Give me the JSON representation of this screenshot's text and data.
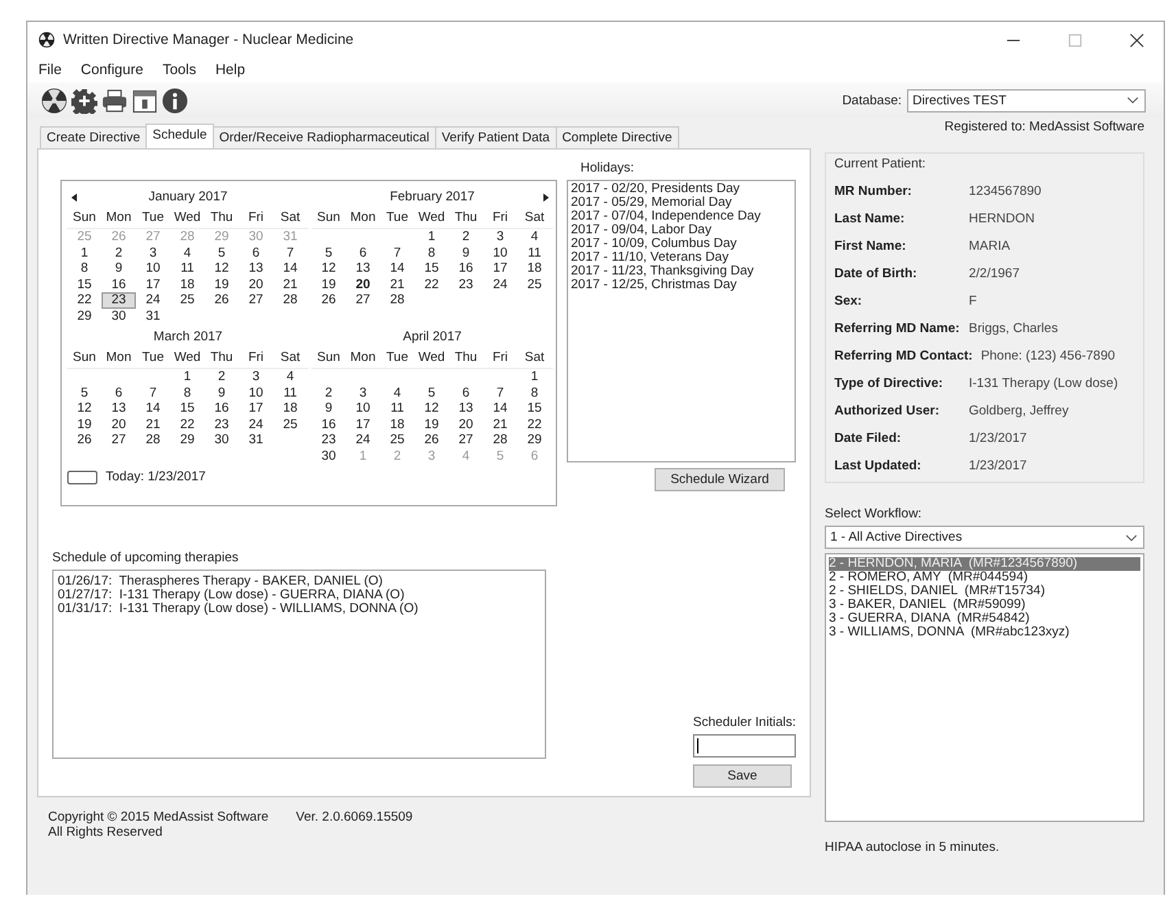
{
  "window": {
    "title": "Written Directive Manager - Nuclear Medicine"
  },
  "menu": [
    "File",
    "Configure",
    "Tools",
    "Help"
  ],
  "toolbar": [
    {
      "kind": "radiation"
    },
    {
      "kind": "gear"
    },
    {
      "kind": "printer"
    },
    {
      "kind": "calendar"
    },
    {
      "kind": "info"
    }
  ],
  "database": {
    "label": "Database:",
    "value": "Directives TEST"
  },
  "registered": "Registered to: MedAssist Software",
  "tabs": [
    {
      "label": "Create Directive",
      "selected": false
    },
    {
      "label": "Schedule",
      "selected": true
    },
    {
      "label": "Order/Receive Radiopharmaceutical",
      "selected": false
    },
    {
      "label": "Verify Patient Data",
      "selected": false
    },
    {
      "label": "Complete Directive",
      "selected": false
    }
  ],
  "calendar": {
    "today": "Today: 1/23/2017",
    "months": [
      {
        "title": "January 2017",
        "weekdays": [
          "Sun",
          "Mon",
          "Tue",
          "Wed",
          "Thu",
          "Fri",
          "Sat"
        ],
        "weeks": [
          [
            {
              "text": "25",
              "kind": "other",
              "selected": false
            },
            {
              "text": "26",
              "kind": "other",
              "selected": false
            },
            {
              "text": "27",
              "kind": "other",
              "selected": false
            },
            {
              "text": "28",
              "kind": "other",
              "selected": false
            },
            {
              "text": "29",
              "kind": "other",
              "selected": false
            },
            {
              "text": "30",
              "kind": "other",
              "selected": false
            },
            {
              "text": "31",
              "kind": "other",
              "selected": false
            }
          ],
          [
            {
              "text": "1",
              "kind": "day",
              "selected": false
            },
            {
              "text": "2",
              "kind": "day",
              "selected": false
            },
            {
              "text": "3",
              "kind": "day",
              "selected": false
            },
            {
              "text": "4",
              "kind": "day",
              "selected": false
            },
            {
              "text": "5",
              "kind": "day",
              "selected": false
            },
            {
              "text": "6",
              "kind": "day",
              "selected": false
            },
            {
              "text": "7",
              "kind": "day",
              "selected": false
            }
          ],
          [
            {
              "text": "8",
              "kind": "day",
              "selected": false
            },
            {
              "text": "9",
              "kind": "day",
              "selected": false
            },
            {
              "text": "10",
              "kind": "day",
              "selected": false
            },
            {
              "text": "11",
              "kind": "day",
              "selected": false
            },
            {
              "text": "12",
              "kind": "day",
              "selected": false
            },
            {
              "text": "13",
              "kind": "day",
              "selected": false
            },
            {
              "text": "14",
              "kind": "day",
              "selected": false
            }
          ],
          [
            {
              "text": "15",
              "kind": "day",
              "selected": false
            },
            {
              "text": "16",
              "kind": "day",
              "selected": false
            },
            {
              "text": "17",
              "kind": "day",
              "selected": false
            },
            {
              "text": "18",
              "kind": "day",
              "selected": false
            },
            {
              "text": "19",
              "kind": "day",
              "selected": false
            },
            {
              "text": "20",
              "kind": "day",
              "selected": false
            },
            {
              "text": "21",
              "kind": "day",
              "selected": false
            }
          ],
          [
            {
              "text": "22",
              "kind": "day",
              "selected": false
            },
            {
              "text": "23",
              "kind": "day",
              "selected": true
            },
            {
              "text": "24",
              "kind": "day",
              "selected": false
            },
            {
              "text": "25",
              "kind": "day",
              "selected": false
            },
            {
              "text": "26",
              "kind": "day",
              "selected": false
            },
            {
              "text": "27",
              "kind": "day",
              "selected": false
            },
            {
              "text": "28",
              "kind": "day",
              "selected": false
            }
          ],
          [
            {
              "text": "29",
              "kind": "day",
              "selected": false
            },
            {
              "text": "30",
              "kind": "day",
              "selected": false
            },
            {
              "text": "31",
              "kind": "day",
              "selected": false
            }
          ]
        ]
      },
      {
        "title": "February 2017",
        "weekdays": [
          "Sun",
          "Mon",
          "Tue",
          "Wed",
          "Thu",
          "Fri",
          "Sat"
        ],
        "weeks": [
          [
            {
              "text": "1",
              "kind": "day",
              "selected": false
            },
            {
              "text": "2",
              "kind": "day",
              "selected": false
            },
            {
              "text": "3",
              "kind": "day",
              "selected": false
            },
            {
              "text": "4",
              "kind": "day",
              "selected": false
            }
          ],
          [
            {
              "text": "5",
              "kind": "day",
              "selected": false
            },
            {
              "text": "6",
              "kind": "day",
              "selected": false
            },
            {
              "text": "7",
              "kind": "day",
              "selected": false
            },
            {
              "text": "8",
              "kind": "day",
              "selected": false
            },
            {
              "text": "9",
              "kind": "day",
              "selected": false
            },
            {
              "text": "10",
              "kind": "day",
              "selected": false
            },
            {
              "text": "11",
              "kind": "day",
              "selected": false
            }
          ],
          [
            {
              "text": "12",
              "kind": "day",
              "selected": false
            },
            {
              "text": "13",
              "kind": "day",
              "selected": false
            },
            {
              "text": "14",
              "kind": "day",
              "selected": false
            },
            {
              "text": "15",
              "kind": "day",
              "selected": false
            },
            {
              "text": "16",
              "kind": "day",
              "selected": false
            },
            {
              "text": "17",
              "kind": "day",
              "selected": false
            },
            {
              "text": "18",
              "kind": "day",
              "selected": false
            }
          ],
          [
            {
              "text": "19",
              "kind": "day",
              "selected": false
            },
            {
              "text": "20",
              "kind": "holiday",
              "selected": false
            },
            {
              "text": "21",
              "kind": "day",
              "selected": false
            },
            {
              "text": "22",
              "kind": "day",
              "selected": false
            },
            {
              "text": "23",
              "kind": "day",
              "selected": false
            },
            {
              "text": "24",
              "kind": "day",
              "selected": false
            },
            {
              "text": "25",
              "kind": "day",
              "selected": false
            }
          ],
          [
            {
              "text": "26",
              "kind": "day",
              "selected": false
            },
            {
              "text": "27",
              "kind": "day",
              "selected": false
            },
            {
              "text": "28",
              "kind": "day",
              "selected": false
            }
          ]
        ]
      },
      {
        "title": "March 2017",
        "weekdays": [
          "Sun",
          "Mon",
          "Tue",
          "Wed",
          "Thu",
          "Fri",
          "Sat"
        ],
        "weeks": [
          [
            {
              "text": "1",
              "kind": "day",
              "selected": false
            },
            {
              "text": "2",
              "kind": "day",
              "selected": false
            },
            {
              "text": "3",
              "kind": "day",
              "selected": false
            },
            {
              "text": "4",
              "kind": "day",
              "selected": false
            }
          ],
          [
            {
              "text": "5",
              "kind": "day",
              "selected": false
            },
            {
              "text": "6",
              "kind": "day",
              "selected": false
            },
            {
              "text": "7",
              "kind": "day",
              "selected": false
            },
            {
              "text": "8",
              "kind": "day",
              "selected": false
            },
            {
              "text": "9",
              "kind": "day",
              "selected": false
            },
            {
              "text": "10",
              "kind": "day",
              "selected": false
            },
            {
              "text": "11",
              "kind": "day",
              "selected": false
            }
          ],
          [
            {
              "text": "12",
              "kind": "day",
              "selected": false
            },
            {
              "text": "13",
              "kind": "day",
              "selected": false
            },
            {
              "text": "14",
              "kind": "day",
              "selected": false
            },
            {
              "text": "15",
              "kind": "day",
              "selected": false
            },
            {
              "text": "16",
              "kind": "day",
              "selected": false
            },
            {
              "text": "17",
              "kind": "day",
              "selected": false
            },
            {
              "text": "18",
              "kind": "day",
              "selected": false
            }
          ],
          [
            {
              "text": "19",
              "kind": "day",
              "selected": false
            },
            {
              "text": "20",
              "kind": "day",
              "selected": false
            },
            {
              "text": "21",
              "kind": "day",
              "selected": false
            },
            {
              "text": "22",
              "kind": "day",
              "selected": false
            },
            {
              "text": "23",
              "kind": "day",
              "selected": false
            },
            {
              "text": "24",
              "kind": "day",
              "selected": false
            },
            {
              "text": "25",
              "kind": "day",
              "selected": false
            }
          ],
          [
            {
              "text": "26",
              "kind": "day",
              "selected": false
            },
            {
              "text": "27",
              "kind": "day",
              "selected": false
            },
            {
              "text": "28",
              "kind": "day",
              "selected": false
            },
            {
              "text": "29",
              "kind": "day",
              "selected": false
            },
            {
              "text": "30",
              "kind": "day",
              "selected": false
            },
            {
              "text": "31",
              "kind": "day",
              "selected": false
            }
          ]
        ]
      },
      {
        "title": "April 2017",
        "weekdays": [
          "Sun",
          "Mon",
          "Tue",
          "Wed",
          "Thu",
          "Fri",
          "Sat"
        ],
        "weeks": [
          [
            {
              "text": "1",
              "kind": "day",
              "selected": false
            }
          ],
          [
            {
              "text": "2",
              "kind": "day",
              "selected": false
            },
            {
              "text": "3",
              "kind": "day",
              "selected": false
            },
            {
              "text": "4",
              "kind": "day",
              "selected": false
            },
            {
              "text": "5",
              "kind": "day",
              "selected": false
            },
            {
              "text": "6",
              "kind": "day",
              "selected": false
            },
            {
              "text": "7",
              "kind": "day",
              "selected": false
            },
            {
              "text": "8",
              "kind": "day",
              "selected": false
            }
          ],
          [
            {
              "text": "9",
              "kind": "day",
              "selected": false
            },
            {
              "text": "10",
              "kind": "day",
              "selected": false
            },
            {
              "text": "11",
              "kind": "day",
              "selected": false
            },
            {
              "text": "12",
              "kind": "day",
              "selected": false
            },
            {
              "text": "13",
              "kind": "day",
              "selected": false
            },
            {
              "text": "14",
              "kind": "day",
              "selected": false
            },
            {
              "text": "15",
              "kind": "day",
              "selected": false
            }
          ],
          [
            {
              "text": "16",
              "kind": "day",
              "selected": false
            },
            {
              "text": "17",
              "kind": "day",
              "selected": false
            },
            {
              "text": "18",
              "kind": "day",
              "selected": false
            },
            {
              "text": "19",
              "kind": "day",
              "selected": false
            },
            {
              "text": "20",
              "kind": "day",
              "selected": false
            },
            {
              "text": "21",
              "kind": "day",
              "selected": false
            },
            {
              "text": "22",
              "kind": "day",
              "selected": false
            }
          ],
          [
            {
              "text": "23",
              "kind": "day",
              "selected": false
            },
            {
              "text": "24",
              "kind": "day",
              "selected": false
            },
            {
              "text": "25",
              "kind": "day",
              "selected": false
            },
            {
              "text": "26",
              "kind": "day",
              "selected": false
            },
            {
              "text": "27",
              "kind": "day",
              "selected": false
            },
            {
              "text": "28",
              "kind": "day",
              "selected": false
            },
            {
              "text": "29",
              "kind": "day",
              "selected": false
            }
          ],
          [
            {
              "text": "30",
              "kind": "day",
              "selected": false
            },
            {
              "text": "1",
              "kind": "other",
              "selected": false
            },
            {
              "text": "2",
              "kind": "other",
              "selected": false
            },
            {
              "text": "3",
              "kind": "other",
              "selected": false
            },
            {
              "text": "4",
              "kind": "other",
              "selected": false
            },
            {
              "text": "5",
              "kind": "other",
              "selected": false
            },
            {
              "text": "6",
              "kind": "other",
              "selected": false
            }
          ]
        ]
      }
    ]
  },
  "holidays": {
    "label": "Holidays:",
    "items": [
      "2017 - 02/20, Presidents Day",
      "2017 - 05/29, Memorial Day",
      "2017 - 07/04, Independence Day",
      "2017 - 09/04, Labor Day",
      "2017 - 10/09, Columbus Day",
      "2017 - 11/10, Veterans Day",
      "2017 - 11/23, Thanksgiving Day",
      "2017 - 12/25, Christmas Day"
    ]
  },
  "schedule_wizard": "Schedule Wizard",
  "schedule": {
    "label": "Schedule of upcoming therapies",
    "items": [
      "01/26/17:  Theraspheres Therapy - BAKER, DANIEL (O)",
      "01/27/17:  I-131 Therapy (Low dose) - GUERRA, DIANA (O)",
      "01/31/17:  I-131 Therapy (Low dose) - WILLIAMS, DONNA (O)"
    ]
  },
  "initials": {
    "label": "Scheduler Initials:"
  },
  "save": "Save",
  "footer": {
    "copyright": "Copyright © 2015 MedAssist Software",
    "rights": "All Rights Reserved",
    "version": "Ver. 2.0.6069.15509"
  },
  "current_patient": {
    "title": "Current Patient:",
    "fields": [
      {
        "label": "MR Number:",
        "value": "1234567890"
      },
      {
        "label": "Last Name:",
        "value": "HERNDON"
      },
      {
        "label": "First Name:",
        "value": "MARIA"
      },
      {
        "label": "Date of Birth:",
        "value": "2/2/1967"
      },
      {
        "label": "Sex:",
        "value": "F"
      },
      {
        "label": "Referring MD Name:",
        "value": "Briggs, Charles"
      },
      {
        "label": "Referring MD Contact:",
        "value": "Phone: (123) 456-7890"
      },
      {
        "label": "Type of Directive:",
        "value": "I-131 Therapy (Low dose)"
      },
      {
        "label": "Authorized User:",
        "value": "Goldberg, Jeffrey"
      },
      {
        "label": "Date Filed:",
        "value": "1/23/2017"
      },
      {
        "label": "Last Updated:",
        "value": "1/23/2017"
      }
    ]
  },
  "workflow": {
    "label": "Select Workflow:",
    "value": "1 - All Active Directives",
    "items": [
      {
        "text": "2 - HERNDON, MARIA  (MR#1234567890)",
        "selected": true
      },
      {
        "text": "2 - ROMERO, AMY  (MR#044594)",
        "selected": false
      },
      {
        "text": "2 - SHIELDS, DANIEL  (MR#T15734)",
        "selected": false
      },
      {
        "text": "3 - BAKER, DANIEL  (MR#59099)",
        "selected": false
      },
      {
        "text": "3 - GUERRA, DIANA  (MR#54842)",
        "selected": false
      },
      {
        "text": "3 - WILLIAMS, DONNA  (MR#abc123xyz)",
        "selected": false
      }
    ]
  },
  "hipaa": "HIPAA autoclose in 5 minutes."
}
